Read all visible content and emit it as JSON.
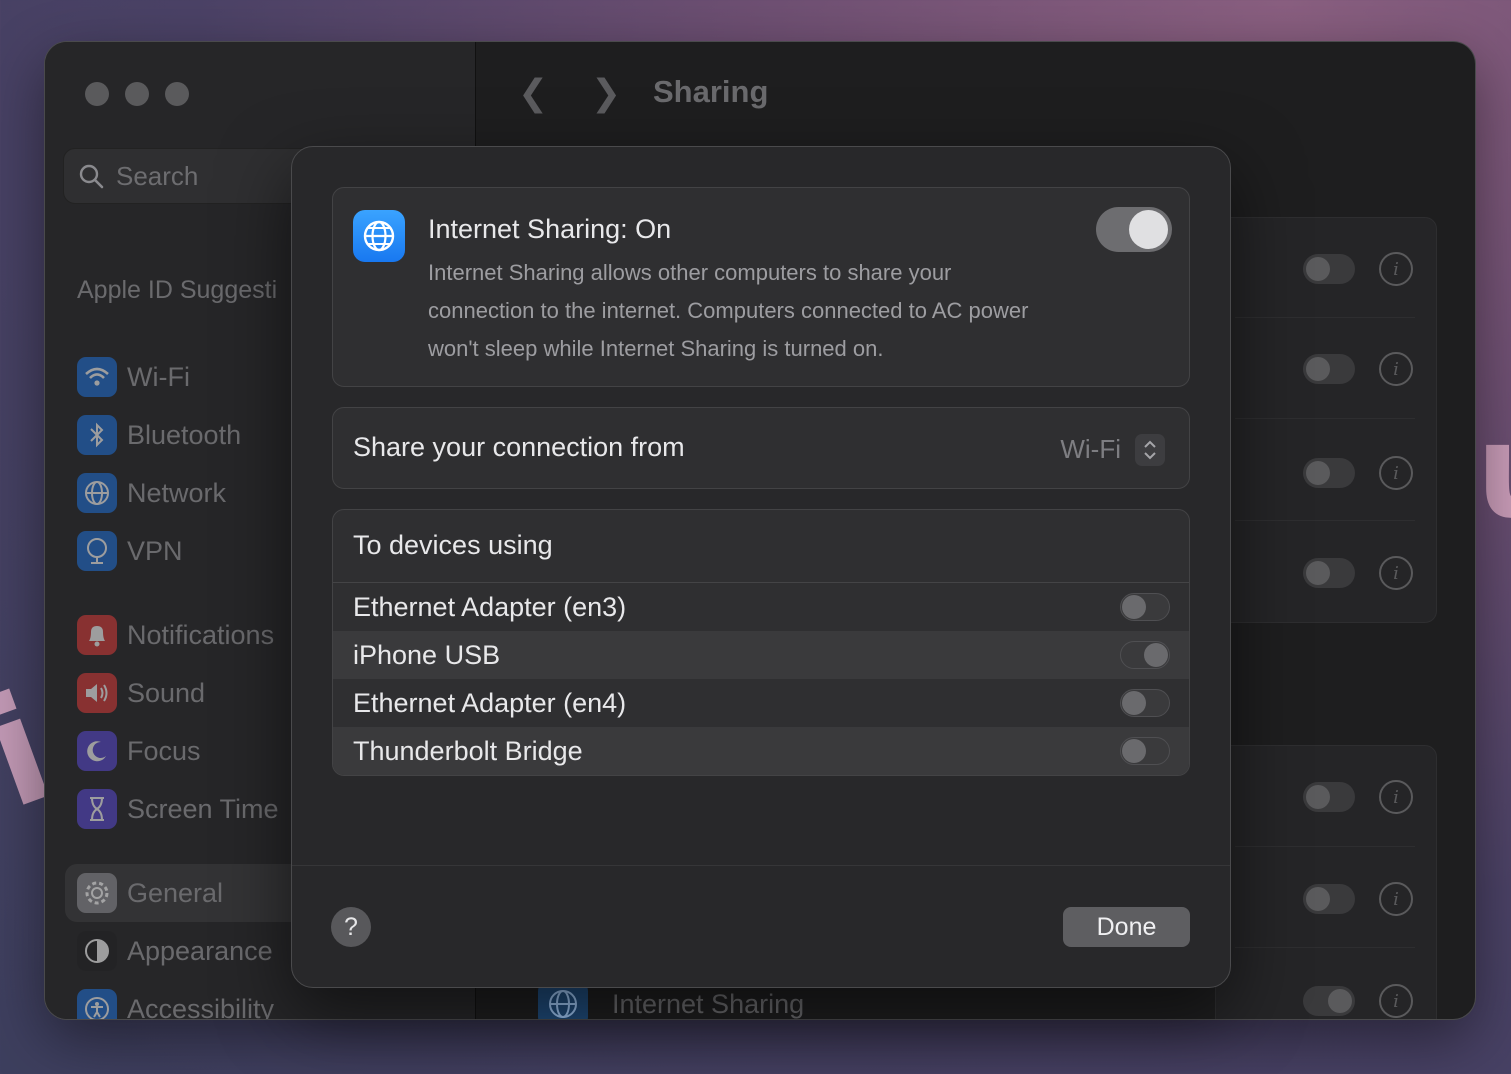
{
  "window": {
    "title": "Sharing",
    "search_placeholder": "Search"
  },
  "sidebar": {
    "section_title": "Apple ID Suggesti",
    "items": [
      {
        "label": "Wi-Fi",
        "icon": "wifi-icon",
        "color": "#1f6fd6"
      },
      {
        "label": "Bluetooth",
        "icon": "bluetooth-icon",
        "color": "#1f6fd6"
      },
      {
        "label": "Network",
        "icon": "globe-icon",
        "color": "#1f6fd6"
      },
      {
        "label": "VPN",
        "icon": "vpn-globe-icon",
        "color": "#1f6fd6"
      },
      {
        "label": "Notifications",
        "icon": "bell-icon",
        "color": "#d93a3a"
      },
      {
        "label": "Sound",
        "icon": "speaker-icon",
        "color": "#d93a3a"
      },
      {
        "label": "Focus",
        "icon": "moon-icon",
        "color": "#5a4ad1"
      },
      {
        "label": "Screen Time",
        "icon": "hourglass-icon",
        "color": "#5a4ad1"
      },
      {
        "label": "General",
        "icon": "gear-icon",
        "color": "#8a8a8e"
      },
      {
        "label": "Appearance",
        "icon": "appearance-icon",
        "color": "#222224"
      },
      {
        "label": "Accessibility",
        "icon": "accessibility-icon",
        "color": "#1f6fd6"
      }
    ],
    "active": "General"
  },
  "background_list": {
    "visible_item": "Internet Sharing",
    "toggles": [
      false,
      false,
      false,
      false,
      false,
      false,
      true
    ]
  },
  "dialog": {
    "status_title": "Internet Sharing: On",
    "status_description": "Internet Sharing allows other computers to share your connection to the internet. Computers connected to AC power won't sleep while Internet Sharing is turned on.",
    "status_enabled": true,
    "share_from_label": "Share your connection from",
    "share_from_value": "Wi-Fi",
    "devices_heading": "To devices using",
    "devices": [
      {
        "label": "Ethernet Adapter (en3)",
        "enabled": false
      },
      {
        "label": "iPhone USB",
        "enabled": true
      },
      {
        "label": "Ethernet Adapter (en4)",
        "enabled": false
      },
      {
        "label": "Thunderbolt Bridge",
        "enabled": false
      }
    ],
    "help_label": "?",
    "done_label": "Done"
  }
}
